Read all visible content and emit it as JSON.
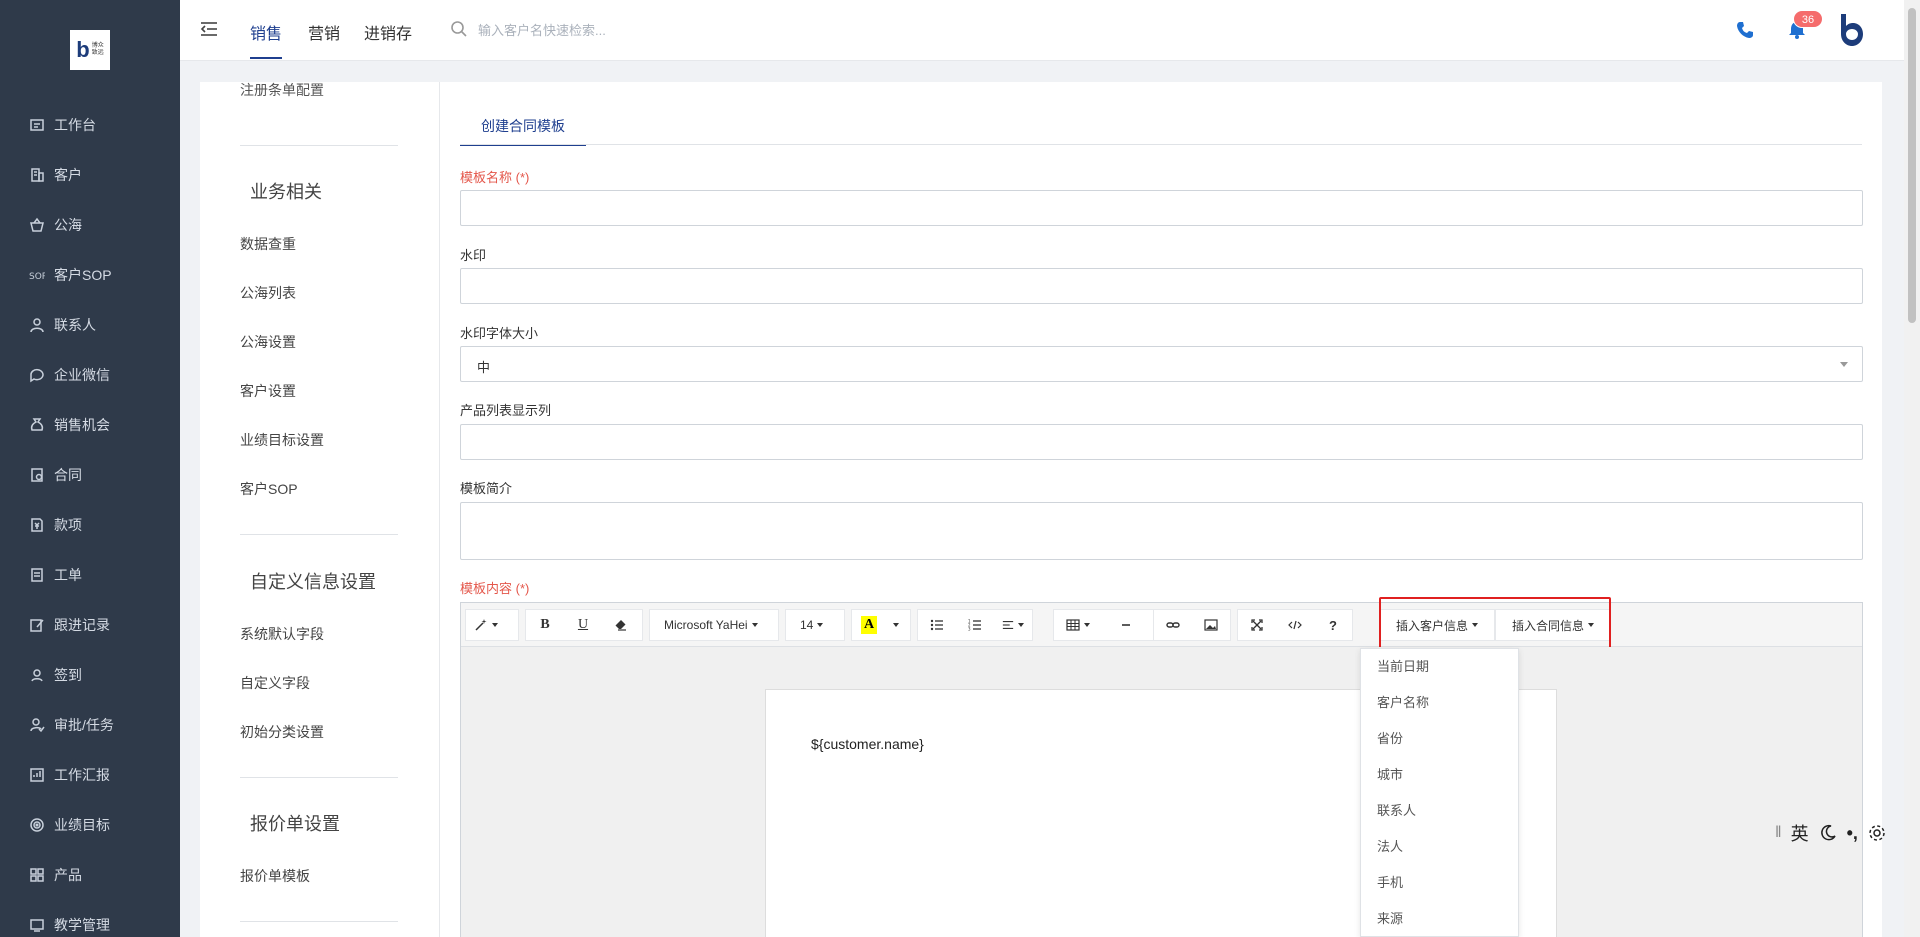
{
  "sidebar": {
    "logo": {
      "mark": "b",
      "text_line1": "博众",
      "text_line2": "致远"
    },
    "items": [
      {
        "label": "工作台",
        "icon": "dashboard-icon"
      },
      {
        "label": "客户",
        "icon": "building-icon"
      },
      {
        "label": "公海",
        "icon": "basket-icon"
      },
      {
        "label": "客户SOP",
        "icon": "sop-icon"
      },
      {
        "label": "联系人",
        "icon": "contact-icon"
      },
      {
        "label": "企业微信",
        "icon": "chat-icon"
      },
      {
        "label": "销售机会",
        "icon": "money-bag-icon"
      },
      {
        "label": "合同",
        "icon": "contract-icon"
      },
      {
        "label": "款项",
        "icon": "payment-icon"
      },
      {
        "label": "工单",
        "icon": "ticket-icon"
      },
      {
        "label": "跟进记录",
        "icon": "edit-icon"
      },
      {
        "label": "签到",
        "icon": "location-icon"
      },
      {
        "label": "审批/任务",
        "icon": "approval-icon"
      },
      {
        "label": "工作汇报",
        "icon": "report-icon"
      },
      {
        "label": "业绩目标",
        "icon": "target-icon"
      },
      {
        "label": "产品",
        "icon": "grid-icon"
      },
      {
        "label": "教学管理",
        "icon": "teaching-icon"
      }
    ]
  },
  "topbar": {
    "tabs": [
      {
        "label": "销售",
        "active": true
      },
      {
        "label": "营销",
        "active": false
      },
      {
        "label": "进销存",
        "active": false
      }
    ],
    "search_placeholder": "输入客户名快速检索...",
    "notification_count": "36",
    "accent_color": "#1f3f8f"
  },
  "settings_panel": {
    "cut_off_item": "注册条单配置",
    "groups": [
      {
        "title": "业务相关",
        "items": [
          "数据查重",
          "公海列表",
          "公海设置",
          "客户设置",
          "业绩目标设置",
          "客户SOP"
        ]
      },
      {
        "title": "自定义信息设置",
        "items": [
          "系统默认字段",
          "自定义字段",
          "初始分类设置"
        ]
      },
      {
        "title": "报价单设置",
        "items": [
          "报价单模板"
        ]
      }
    ]
  },
  "form": {
    "tab_label": "创建合同模板",
    "fields": {
      "name_label": "模板名称 (*)",
      "name_value": "",
      "watermark_label": "水印",
      "watermark_value": "",
      "watermark_size_label": "水印字体大小",
      "watermark_size_value": "中",
      "product_columns_label": "产品列表显示列",
      "product_columns_value": "",
      "intro_label": "模板简介",
      "intro_value": "",
      "content_label": "模板内容 (*)"
    },
    "required_color": "#e4574b"
  },
  "editor": {
    "toolbar": {
      "font_family": "Microsoft YaHei",
      "font_size": "14",
      "bold": "B",
      "underline": "U",
      "help": "?",
      "insert_customer_info": "插入客户信息",
      "insert_contract_info": "插入合同信息",
      "highlight_color": "#ffff00",
      "callout_border_color": "#e02020"
    },
    "content": "${customer.name}"
  },
  "dropdown": {
    "items": [
      "当前日期",
      "客户名称",
      "省份",
      "城市",
      "联系人",
      "法人",
      "手机",
      "来源"
    ]
  },
  "ime_bar": {
    "lang": "英",
    "punct": "•,"
  }
}
